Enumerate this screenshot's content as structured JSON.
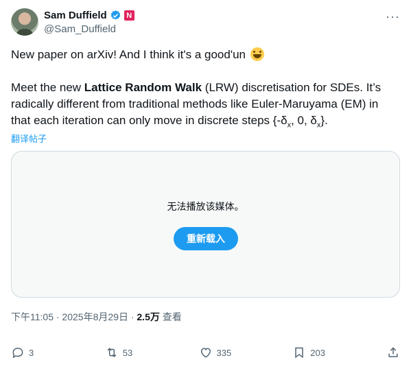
{
  "author": {
    "display_name": "Sam Duffield",
    "handle": "@Sam_Duffield",
    "affiliation_badge": "N"
  },
  "more_label": "···",
  "tweet": {
    "line1": "New paper on arXiv! And I think it's a good'un",
    "p2_before": "Meet the new ",
    "p2_bold": "Lattice Random Walk",
    "p2_after1": " (LRW) discretisation for SDEs. It’s radically different from traditional methods like Euler-Maruyama (EM) in that each iteration can only move in discrete steps {-δ",
    "sub_x1": "x",
    "mid": ", 0, δ",
    "sub_x2": "x",
    "end": "}."
  },
  "translate_label": "翻译帖子",
  "media": {
    "message": "无法播放该媒体。",
    "reload_label": "重新载入"
  },
  "meta": {
    "time": "下午11:05 · 2025年8月29日 · ",
    "views": "2.5万",
    "views_suffix": " 查看"
  },
  "actions": {
    "replies": "3",
    "reposts": "53",
    "likes": "335",
    "bookmarks": "203"
  },
  "colors": {
    "accent": "#1d9bf0",
    "text": "#0f1419",
    "secondary": "#536471",
    "badge": "#e0245e"
  }
}
